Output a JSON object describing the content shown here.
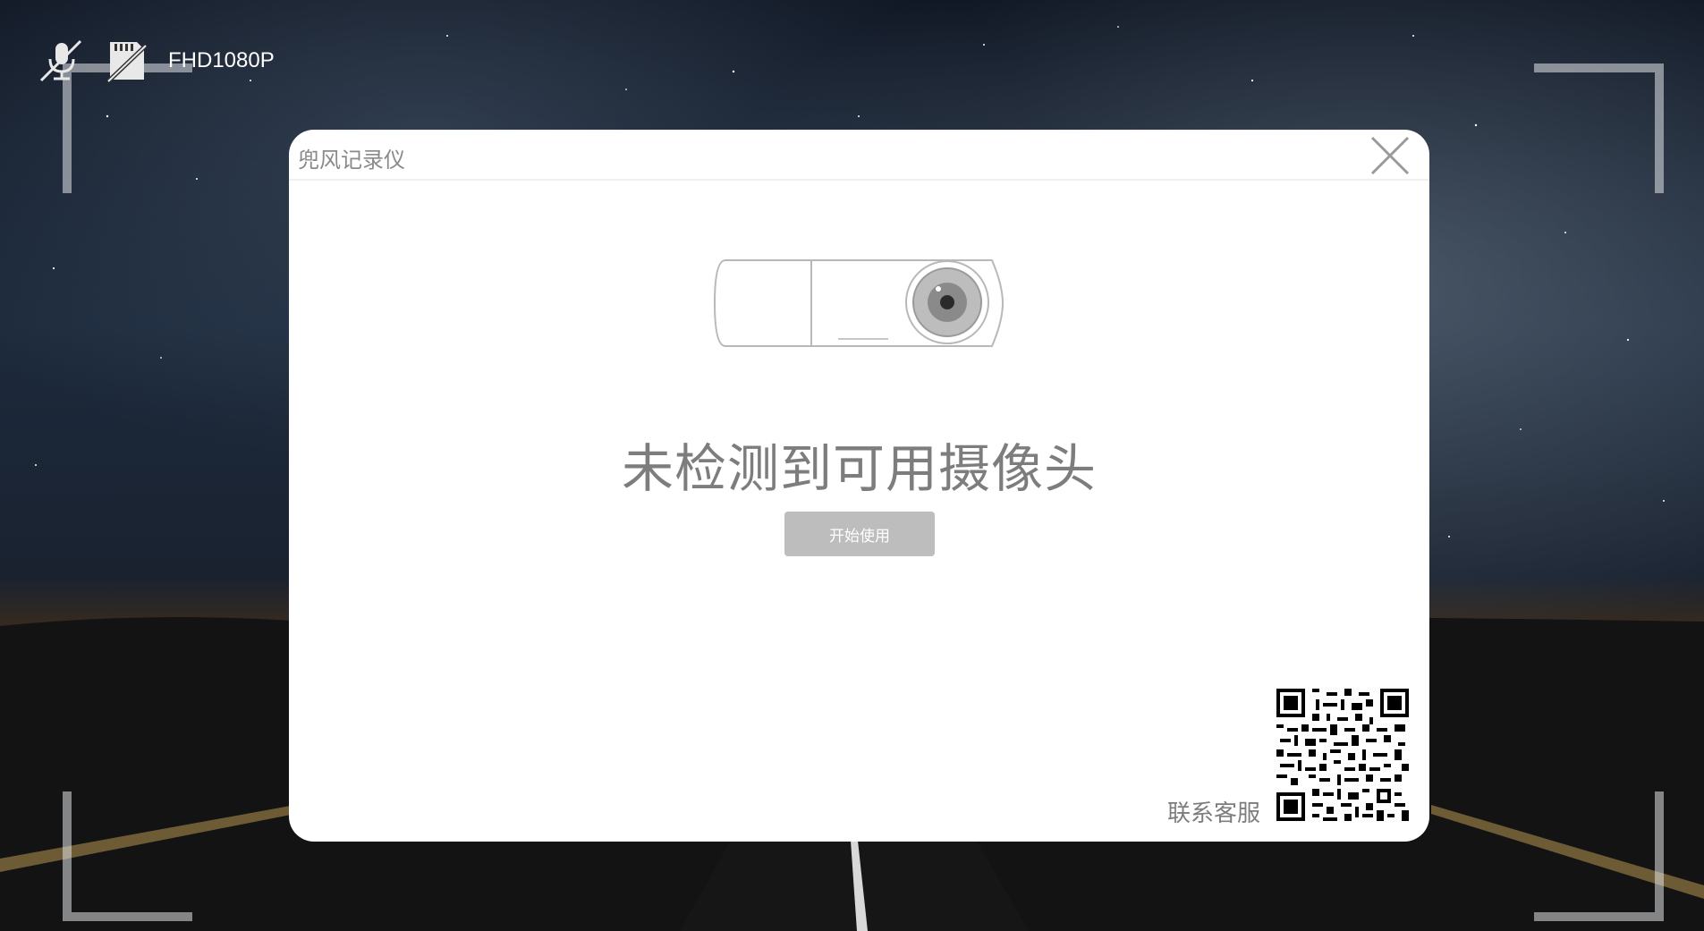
{
  "status_bar": {
    "mic_icon": "microphone-muted-icon",
    "sd_icon": "sd-card-missing-icon",
    "resolution": "FHD1080P"
  },
  "dialog": {
    "title": "兜风记录仪",
    "close_icon": "close-icon",
    "illustration": "dashcam-icon",
    "message": "未检测到可用摄像头",
    "start_button": "开始使用",
    "contact_label": "联系客服",
    "qr_icon": "qr-code-icon"
  },
  "colors": {
    "dialog_bg": "#ffffff",
    "text_gray": "#7d7d7d",
    "button_bg": "#bdbdbd"
  }
}
